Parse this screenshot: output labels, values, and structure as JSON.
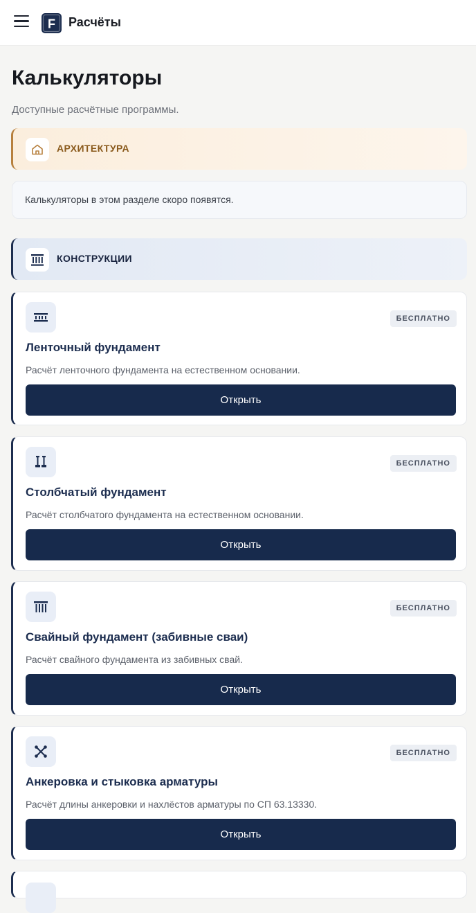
{
  "header": {
    "menu_icon": "hamburger-menu-icon",
    "logo_letter": "F",
    "app_title": "Расчёты"
  },
  "page": {
    "title": "Калькуляторы",
    "subtitle": "Доступные расчётные программы."
  },
  "sections": [
    {
      "label": "АРХИТЕКТУРА",
      "icon": "house-icon",
      "accent": "#b7803e",
      "empty_text": "Калькуляторы в этом разделе скоро появятся."
    },
    {
      "label": "КОНСТРУКЦИИ",
      "icon": "columns-building-icon",
      "accent": "#1c2d4f"
    }
  ],
  "cards": [
    {
      "icon": "strip-foundation-icon",
      "badge": "БЕСПЛАТНО",
      "title": "Ленточный фундамент",
      "desc": "Расчёт ленточного фундамента на естественном основании.",
      "button": "Открыть"
    },
    {
      "icon": "column-foundation-icon",
      "badge": "БЕСПЛАТНО",
      "title": "Столбчатый фундамент",
      "desc": "Расчёт столбчатого фундамента на естественном основании.",
      "button": "Открыть"
    },
    {
      "icon": "pile-foundation-icon",
      "badge": "БЕСПЛАТНО",
      "title": "Свайный фундамент (забивные сваи)",
      "desc": "Расчёт свайного фундамента из забивных свай.",
      "button": "Открыть"
    },
    {
      "icon": "rebar-anchorage-icon",
      "badge": "БЕСПЛАТНО",
      "title": "Анкеровка и стыковка арматуры",
      "desc": "Расчёт длины анкеровки и нахлёстов арматуры по СП 63.13330.",
      "button": "Открыть"
    }
  ],
  "colors": {
    "primary": "#172a4c",
    "background": "#f5f5f3",
    "arch_bg": "#fbeedd",
    "constr_bg": "#e2e9f4"
  }
}
